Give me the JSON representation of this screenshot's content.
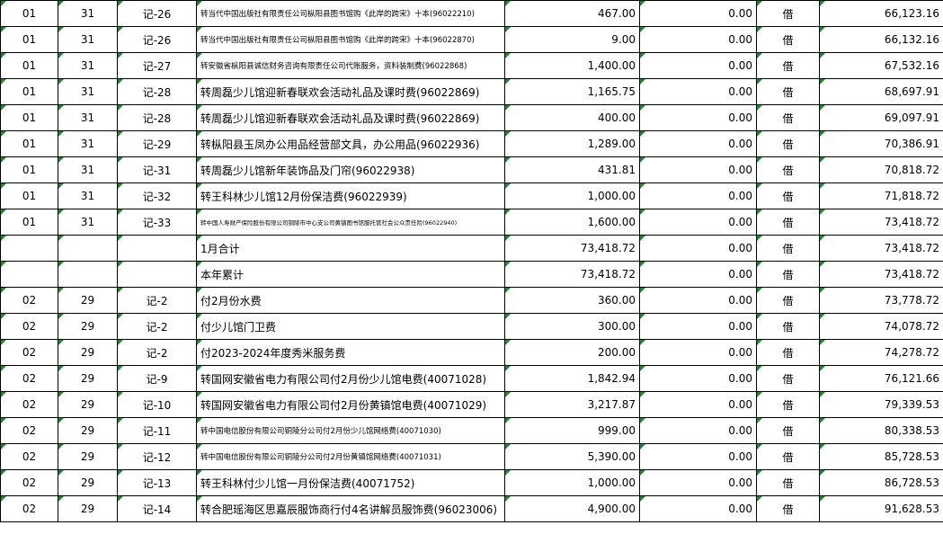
{
  "rows": [
    {
      "month": "01",
      "day": "31",
      "voucher": "记-26",
      "summary": "转当代中国出版社有限责任公司枞阳县图书馆购《此岸的跨宋》十本(96022210)",
      "size": "small",
      "debit": "467.00",
      "credit": "0.00",
      "dir": "借",
      "balance": "66,123.16"
    },
    {
      "month": "01",
      "day": "31",
      "voucher": "记-26",
      "summary": "转当代中国出版社有限责任公司枞阳县图书馆购《此岸的跨宋》十本(96022870)",
      "size": "small",
      "debit": "9.00",
      "credit": "0.00",
      "dir": "借",
      "balance": "66,132.16"
    },
    {
      "month": "01",
      "day": "31",
      "voucher": "记-27",
      "summary": "转安徽省枞阳县诚信财务咨询有限责任公司代账服务，资料装制费(96022868)",
      "size": "small",
      "debit": "1,400.00",
      "credit": "0.00",
      "dir": "借",
      "balance": "67,532.16"
    },
    {
      "month": "01",
      "day": "31",
      "voucher": "记-28",
      "summary": "转周磊少儿馆迎新春联欢会活动礼品及课时费(96022869)",
      "size": "normal",
      "debit": "1,165.75",
      "credit": "0.00",
      "dir": "借",
      "balance": "68,697.91"
    },
    {
      "month": "01",
      "day": "31",
      "voucher": "记-28",
      "summary": "转周磊少儿馆迎新春联欢会活动礼品及课时费(96022869)",
      "size": "normal",
      "debit": "400.00",
      "credit": "0.00",
      "dir": "借",
      "balance": "69,097.91"
    },
    {
      "month": "01",
      "day": "31",
      "voucher": "记-29",
      "summary": "转枞阳县玉凤办公用品经营部文具，办公用品(96022936)",
      "size": "normal",
      "debit": "1,289.00",
      "credit": "0.00",
      "dir": "借",
      "balance": "70,386.91"
    },
    {
      "month": "01",
      "day": "31",
      "voucher": "记-31",
      "summary": "转周磊少儿馆新年装饰品及门帘(96022938)",
      "size": "normal",
      "debit": "431.81",
      "credit": "0.00",
      "dir": "借",
      "balance": "70,818.72"
    },
    {
      "month": "01",
      "day": "31",
      "voucher": "记-32",
      "summary": "转王科林少儿馆12月份保洁费(96022939)",
      "size": "normal",
      "debit": "1,000.00",
      "credit": "0.00",
      "dir": "借",
      "balance": "71,818.72"
    },
    {
      "month": "01",
      "day": "31",
      "voucher": "记-33",
      "summary": "转中国人寿财产保险股份有限公司铜陵市中心支公司黄镇图书馆服托管社会公众责任险(96022940)",
      "size": "tiny",
      "debit": "1,600.00",
      "credit": "0.00",
      "dir": "借",
      "balance": "73,418.72"
    },
    {
      "month": "",
      "day": "",
      "voucher": "",
      "summary": "1月合计",
      "size": "normal",
      "debit": "73,418.72",
      "credit": "0.00",
      "dir": "借",
      "balance": "73,418.72"
    },
    {
      "month": "",
      "day": "",
      "voucher": "",
      "summary": "本年累计",
      "size": "normal",
      "debit": "73,418.72",
      "credit": "0.00",
      "dir": "借",
      "balance": "73,418.72"
    },
    {
      "month": "02",
      "day": "29",
      "voucher": "记-2",
      "summary": "付2月份水费",
      "size": "normal",
      "debit": "360.00",
      "credit": "0.00",
      "dir": "借",
      "balance": "73,778.72"
    },
    {
      "month": "02",
      "day": "29",
      "voucher": "记-2",
      "summary": "付少儿馆门卫费",
      "size": "normal",
      "debit": "300.00",
      "credit": "0.00",
      "dir": "借",
      "balance": "74,078.72"
    },
    {
      "month": "02",
      "day": "29",
      "voucher": "记-2",
      "summary": "付2023-2024年度秀米服务费",
      "size": "normal",
      "debit": "200.00",
      "credit": "0.00",
      "dir": "借",
      "balance": "74,278.72"
    },
    {
      "month": "02",
      "day": "29",
      "voucher": "记-9",
      "summary": "转国网安徽省电力有限公司付2月份少儿馆电费(40071028)",
      "size": "normal",
      "debit": "1,842.94",
      "credit": "0.00",
      "dir": "借",
      "balance": "76,121.66"
    },
    {
      "month": "02",
      "day": "29",
      "voucher": "记-10",
      "summary": "转国网安徽省电力有限公司付2月份黄镇馆电费(40071029)",
      "size": "normal",
      "debit": "3,217.87",
      "credit": "0.00",
      "dir": "借",
      "balance": "79,339.53"
    },
    {
      "month": "02",
      "day": "29",
      "voucher": "记-11",
      "summary": "转中国电信股份有限公司铜陵分公司付2月份少儿馆网络费(40071030)",
      "size": "small",
      "debit": "999.00",
      "credit": "0.00",
      "dir": "借",
      "balance": "80,338.53"
    },
    {
      "month": "02",
      "day": "29",
      "voucher": "记-12",
      "summary": "转中国电信股份有限公司铜陵分公司付2月份黄镇馆网络费(40071031)",
      "size": "small",
      "debit": "5,390.00",
      "credit": "0.00",
      "dir": "借",
      "balance": "85,728.53"
    },
    {
      "month": "02",
      "day": "29",
      "voucher": "记-13",
      "summary": "转王科林付少儿馆一月份保洁费(40071752)",
      "size": "normal",
      "debit": "1,000.00",
      "credit": "0.00",
      "dir": "借",
      "balance": "86,728.53"
    },
    {
      "month": "02",
      "day": "29",
      "voucher": "记-14",
      "summary": "转合肥瑶海区思嘉辰服饰商行付4名讲解员服饰费(96023006)",
      "size": "normal",
      "debit": "4,900.00",
      "credit": "0.00",
      "dir": "借",
      "balance": "91,628.53"
    }
  ]
}
